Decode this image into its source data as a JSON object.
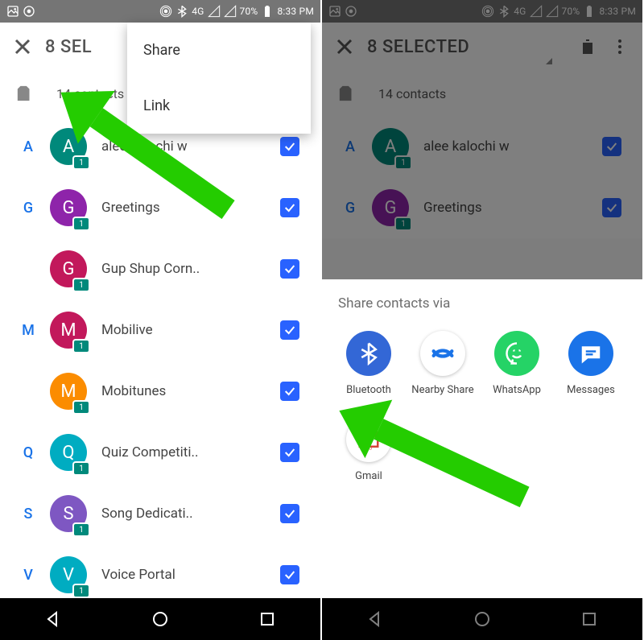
{
  "status": {
    "network": "4G",
    "network_badge": "4G",
    "battery": "70%",
    "time": "8:33 PM"
  },
  "left": {
    "title": "8 SEL",
    "popup": {
      "share": "Share",
      "link": "Link"
    },
    "sim_count": "14 contacts",
    "contacts": [
      {
        "letter": "A",
        "initial": "A",
        "color": "c-green",
        "name": "alee kalochi w",
        "checked": true
      },
      {
        "letter": "G",
        "initial": "G",
        "color": "c-purple",
        "name": "Greetings",
        "checked": true
      },
      {
        "letter": "",
        "initial": "G",
        "color": "c-magenta",
        "name": "Gup Shup Corn..",
        "checked": true
      },
      {
        "letter": "M",
        "initial": "M",
        "color": "c-magenta",
        "name": "Mobilive",
        "checked": true
      },
      {
        "letter": "",
        "initial": "M",
        "color": "c-orange",
        "name": "Mobitunes",
        "checked": true
      },
      {
        "letter": "Q",
        "initial": "Q",
        "color": "c-teal",
        "name": "Quiz Competiti..",
        "checked": true
      },
      {
        "letter": "S",
        "initial": "S",
        "color": "c-violet",
        "name": "Song Dedicati..",
        "checked": true
      },
      {
        "letter": "V",
        "initial": "V",
        "color": "c-teal",
        "name": "Voice Portal",
        "checked": true
      }
    ]
  },
  "right": {
    "title": "8 SELECTED",
    "sim_count": "14 contacts",
    "contacts": [
      {
        "letter": "A",
        "initial": "A",
        "color": "c-green",
        "name": "alee kalochi w",
        "checked": true
      },
      {
        "letter": "G",
        "initial": "G",
        "color": "c-purple",
        "name": "Greetings",
        "checked": true
      }
    ],
    "sheet_title": "Share contacts via",
    "apps": [
      {
        "id": "bluetooth",
        "label": "Bluetooth",
        "color": "#3367d6"
      },
      {
        "id": "nearby",
        "label": "Nearby Share",
        "color": "#ffffff"
      },
      {
        "id": "whatsapp",
        "label": "WhatsApp",
        "color": "#25d366"
      },
      {
        "id": "messages",
        "label": "Messages",
        "color": "#1a73e8"
      },
      {
        "id": "gmail",
        "label": "Gmail",
        "color": "#ffffff"
      }
    ]
  }
}
